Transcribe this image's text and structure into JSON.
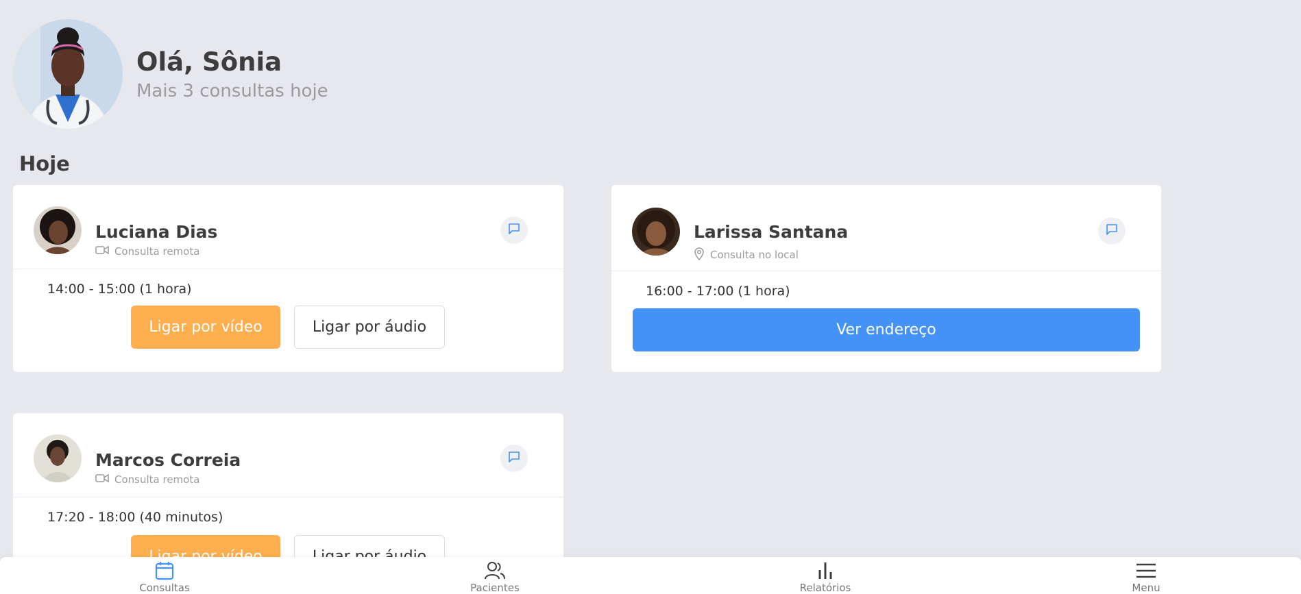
{
  "header": {
    "greeting": "Olá, Sônia",
    "subtitle": "Mais 3 consultas hoje"
  },
  "section_title": "Hoje",
  "appointments": [
    {
      "name": "Luciana Dias",
      "kind": "Consulta remota",
      "kind_icon": "video-camera-icon",
      "time": "14:00 - 15:00 (1 hora)",
      "video_button": "Ligar por vídeo",
      "audio_button": "Ligar por áudio"
    },
    {
      "name": "Larissa Santana",
      "kind": "Consulta no local",
      "kind_icon": "map-pin-icon",
      "time": "16:00 - 17:00 (1 hora)",
      "address_button": "Ver endereço"
    },
    {
      "name": "Marcos Correia",
      "kind": "Consulta remota",
      "kind_icon": "video-camera-icon",
      "time": "17:20 - 18:00 (40 minutos)",
      "video_button": "Ligar por vídeo",
      "audio_button": "Ligar por áudio"
    }
  ],
  "nav": {
    "items": [
      {
        "label": "Consultas",
        "icon": "calendar-icon",
        "active": true
      },
      {
        "label": "Pacientes",
        "icon": "users-icon",
        "active": false
      },
      {
        "label": "Relatórios",
        "icon": "bar-chart-icon",
        "active": false
      },
      {
        "label": "Menu",
        "icon": "hamburger-menu-icon",
        "active": false
      }
    ]
  },
  "colors": {
    "background": "#e7e8ee",
    "video_button": "#fdaf4f",
    "address_button": "#4492f6",
    "active_icon": "#4492f6",
    "chat_icon": "#4492f6"
  }
}
